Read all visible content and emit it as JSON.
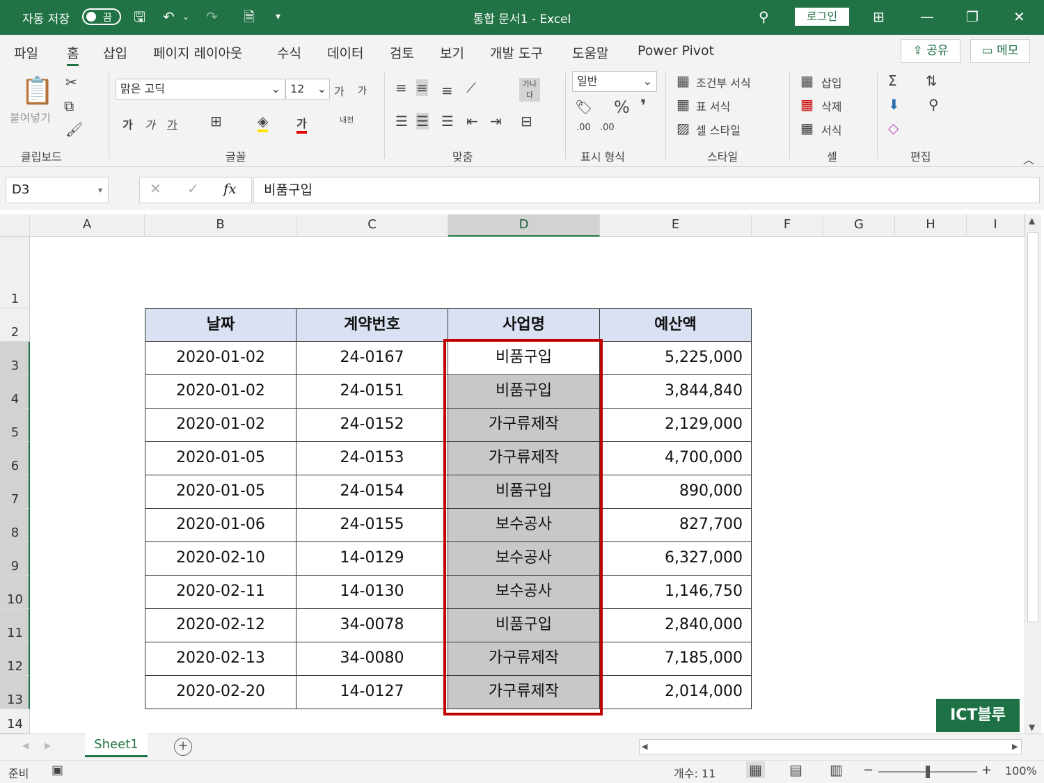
{
  "titlebar": {
    "autosave_label": "자동 저장",
    "autosave_state": "끔",
    "doc_title": "통합 문서1  -  Excel",
    "login_label": "로그인"
  },
  "menu": [
    "파일",
    "홈",
    "삽입",
    "페이지 레이아웃",
    "수식",
    "데이터",
    "검토",
    "보기",
    "개발 도구",
    "도움말",
    "Power Pivot"
  ],
  "share_label": "공유",
  "memo_label": "메모",
  "ribbon": {
    "paste_label": "붙여넣기",
    "font_name": "맑은 고딕",
    "font_size": "12",
    "grow_font": "가",
    "shrink_font": "가",
    "bold": "가",
    "italic": "가",
    "underline": "가",
    "font_color_glyph": "가",
    "phonetic": "내천",
    "wrap_text": "가나다",
    "number_format": "일반",
    "percent": "%",
    "comma": "❜",
    "inc_decimal": ".00",
    "dec_decimal": ".00",
    "conditional_format": "조건부 서식",
    "format_as_table": "표 서식",
    "cell_styles": "셀 스타일",
    "insert": "삽입",
    "delete": "삭제",
    "format": "서식",
    "groups": [
      "클립보드",
      "글꼴",
      "맞춤",
      "표시 형식",
      "스타일",
      "셀",
      "편집"
    ]
  },
  "formula_bar": {
    "name_box": "D3",
    "fx_label": "fx",
    "formula": "비품구입"
  },
  "columns": [
    "A",
    "B",
    "C",
    "D",
    "E",
    "F",
    "G",
    "H",
    "I"
  ],
  "rows": [
    "1",
    "2",
    "3",
    "4",
    "5",
    "6",
    "7",
    "8",
    "9",
    "10",
    "11",
    "12",
    "13",
    "14"
  ],
  "table": {
    "headers": [
      "날짜",
      "계약번호",
      "사업명",
      "예산액"
    ],
    "rows": [
      [
        "2020-01-02",
        "24-0167",
        "비품구입",
        "5,225,000"
      ],
      [
        "2020-01-02",
        "24-0151",
        "비품구입",
        "3,844,840"
      ],
      [
        "2020-01-02",
        "24-0152",
        "가구류제작",
        "2,129,000"
      ],
      [
        "2020-01-05",
        "24-0153",
        "가구류제작",
        "4,700,000"
      ],
      [
        "2020-01-05",
        "24-0154",
        "비품구입",
        "890,000"
      ],
      [
        "2020-01-06",
        "24-0155",
        "보수공사",
        "827,700"
      ],
      [
        "2020-02-10",
        "14-0129",
        "보수공사",
        "6,327,000"
      ],
      [
        "2020-02-11",
        "14-0130",
        "보수공사",
        "1,146,750"
      ],
      [
        "2020-02-12",
        "34-0078",
        "비품구입",
        "2,840,000"
      ],
      [
        "2020-02-13",
        "34-0080",
        "가구류제작",
        "7,185,000"
      ],
      [
        "2020-02-20",
        "14-0127",
        "가구류제작",
        "2,014,000"
      ]
    ]
  },
  "sheet_tab": "Sheet1",
  "status": {
    "ready": "준비",
    "count": "개수: 11",
    "zoom": "100%"
  },
  "watermark": "ICT블루",
  "colors": {
    "accent": "#217346",
    "header_fill": "#d9e1f2",
    "selected_fill": "#c8c8c8",
    "highlight_border": "#c00000"
  }
}
